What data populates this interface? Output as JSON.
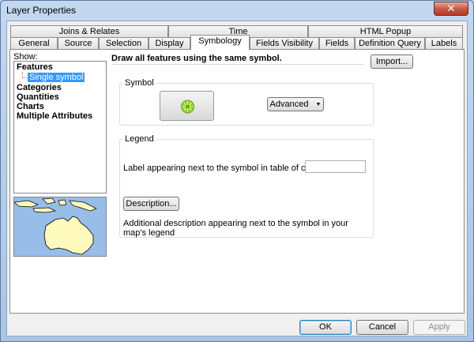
{
  "window": {
    "title": "Layer Properties",
    "close_glyph": "✕"
  },
  "tabs_top": [
    {
      "label": "Joins & Relates"
    },
    {
      "label": "Time"
    },
    {
      "label": "HTML Popup"
    }
  ],
  "tabs_bottom": [
    {
      "label": "General"
    },
    {
      "label": "Source"
    },
    {
      "label": "Selection"
    },
    {
      "label": "Display"
    },
    {
      "label": "Symbology",
      "active": true
    },
    {
      "label": "Fields Visibility"
    },
    {
      "label": "Fields"
    },
    {
      "label": "Definition Query"
    },
    {
      "label": "Labels"
    }
  ],
  "show": {
    "label": "Show:",
    "items": [
      "Features",
      "Single symbol",
      "Categories",
      "Quantities",
      "Charts",
      "Multiple Attributes"
    ]
  },
  "header": {
    "text": "Draw all features using the same symbol.",
    "import_label": "Import..."
  },
  "symbol_group": {
    "title": "Symbol",
    "advanced_label": "Advanced",
    "symbol_color": "#8fd12c"
  },
  "legend_group": {
    "title": "Legend",
    "label_prompt": "Label appearing next to the symbol in table of contents:",
    "label_value": "",
    "description_button": "Description...",
    "description_note": "Additional description appearing next to the symbol in your map's legend"
  },
  "footer": {
    "ok": "OK",
    "cancel": "Cancel",
    "apply": "Apply"
  },
  "colors": {
    "selection": "#3399ff",
    "preview_water": "#97bde8",
    "preview_land": "#fffbbd"
  }
}
